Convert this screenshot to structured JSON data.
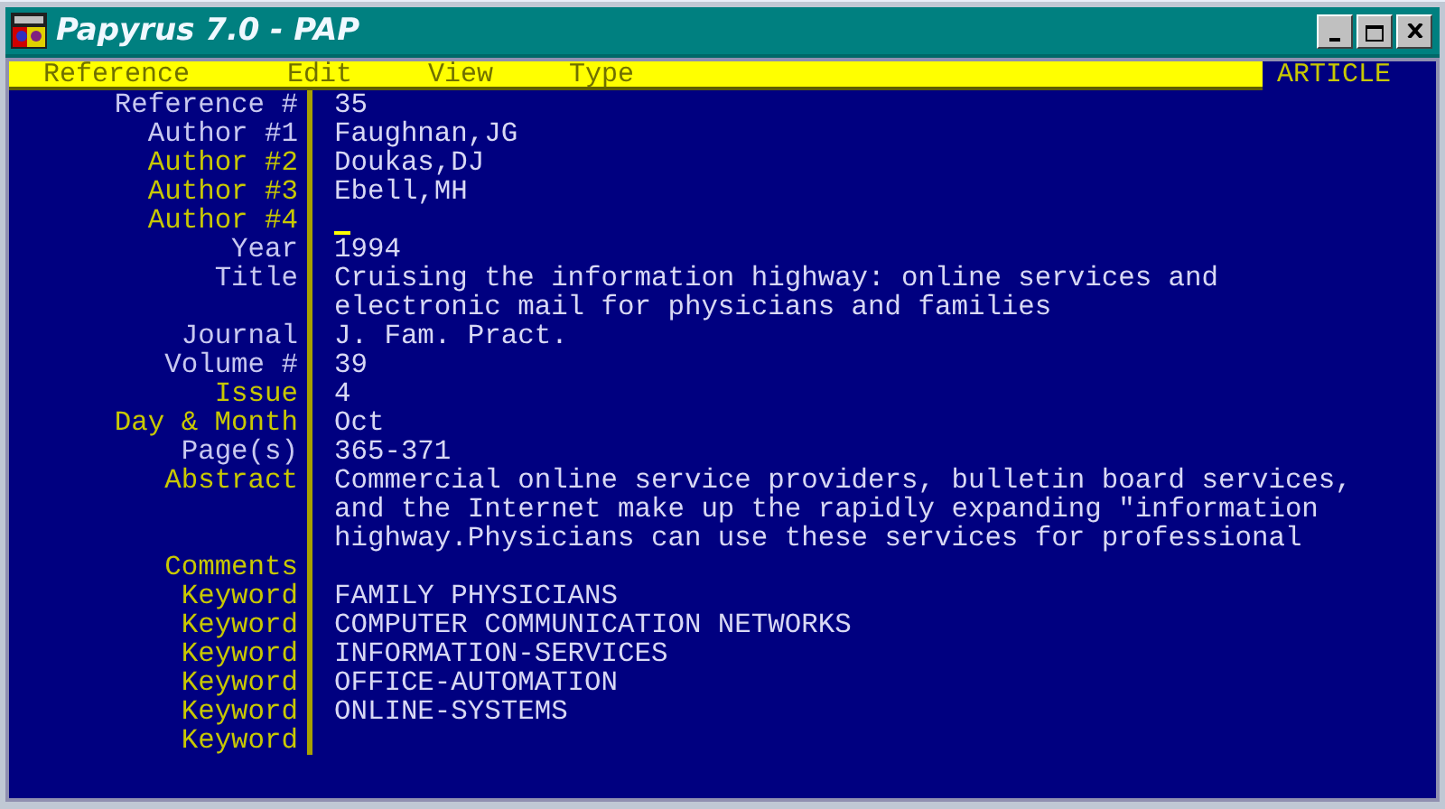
{
  "window": {
    "title": "Papyrus 7.0 - PAP"
  },
  "menu": [
    {
      "label": "Reference"
    },
    {
      "label": "Edit"
    },
    {
      "label": "View"
    },
    {
      "label": "Type"
    }
  ],
  "record_type": "ARTICLE",
  "fields": [
    {
      "label": "Reference #",
      "highlighted": false,
      "lines": [
        "35"
      ]
    },
    {
      "label": "Author #1",
      "highlighted": false,
      "lines": [
        "Faughnan,JG"
      ]
    },
    {
      "label": "Author #2",
      "highlighted": true,
      "lines": [
        "Doukas,DJ"
      ]
    },
    {
      "label": "Author #3",
      "highlighted": true,
      "lines": [
        "Ebell,MH"
      ]
    },
    {
      "label": "Author #4",
      "highlighted": true,
      "cursor": true
    },
    {
      "label": "Year",
      "highlighted": false,
      "lines": [
        "1994"
      ]
    },
    {
      "label": "Title",
      "highlighted": false,
      "lines": [
        "Cruising the information highway: online services and",
        "electronic mail for physicians and families"
      ]
    },
    {
      "label": "Journal",
      "highlighted": false,
      "lines": [
        "J. Fam. Pract."
      ]
    },
    {
      "label": "Volume #",
      "highlighted": false,
      "lines": [
        "39"
      ]
    },
    {
      "label": "Issue",
      "highlighted": true,
      "lines": [
        "4"
      ]
    },
    {
      "label": "Day & Month",
      "highlighted": true,
      "lines": [
        "Oct"
      ]
    },
    {
      "label": "Page(s)",
      "highlighted": false,
      "lines": [
        "365-371"
      ]
    },
    {
      "label": "Abstract",
      "highlighted": true,
      "lines": [
        "Commercial online service providers, bulletin board services,",
        "and the Internet make up the rapidly expanding \"information",
        "highway.Physicians can use these services for professional"
      ]
    },
    {
      "label": "Comments",
      "highlighted": true
    },
    {
      "label": "Keyword",
      "highlighted": true,
      "lines": [
        "FAMILY PHYSICIANS"
      ]
    },
    {
      "label": "Keyword",
      "highlighted": true,
      "lines": [
        "COMPUTER COMMUNICATION NETWORKS"
      ]
    },
    {
      "label": "Keyword",
      "highlighted": true,
      "lines": [
        "INFORMATION-SERVICES"
      ]
    },
    {
      "label": "Keyword",
      "highlighted": true,
      "lines": [
        "OFFICE-AUTOMATION"
      ]
    },
    {
      "label": "Keyword",
      "highlighted": true,
      "lines": [
        "ONLINE-SYSTEMS"
      ]
    },
    {
      "label": "Keyword",
      "highlighted": true
    }
  ]
}
